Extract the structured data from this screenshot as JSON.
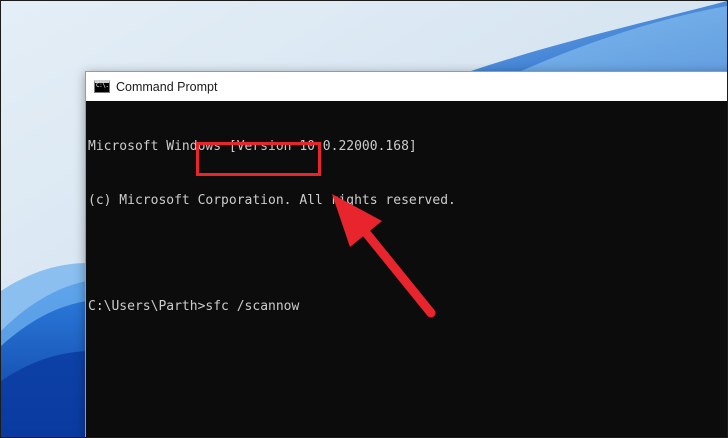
{
  "window": {
    "title": "Command Prompt",
    "icon": "cmd-app-icon",
    "icon_glyph": "C:\\."
  },
  "console": {
    "lines": [
      "Microsoft Windows [Version 10.0.22000.168]",
      "(c) Microsoft Corporation. All rights reserved."
    ],
    "prompt": "C:\\Users\\Parth>",
    "command": "sfc /scannow"
  },
  "annotation": {
    "highlight_color": "#e8242c",
    "arrow_color": "#e8242c"
  },
  "colors": {
    "console_background": "#0c0c0c",
    "console_text": "#cccccc",
    "titlebar_background": "#ffffff"
  }
}
